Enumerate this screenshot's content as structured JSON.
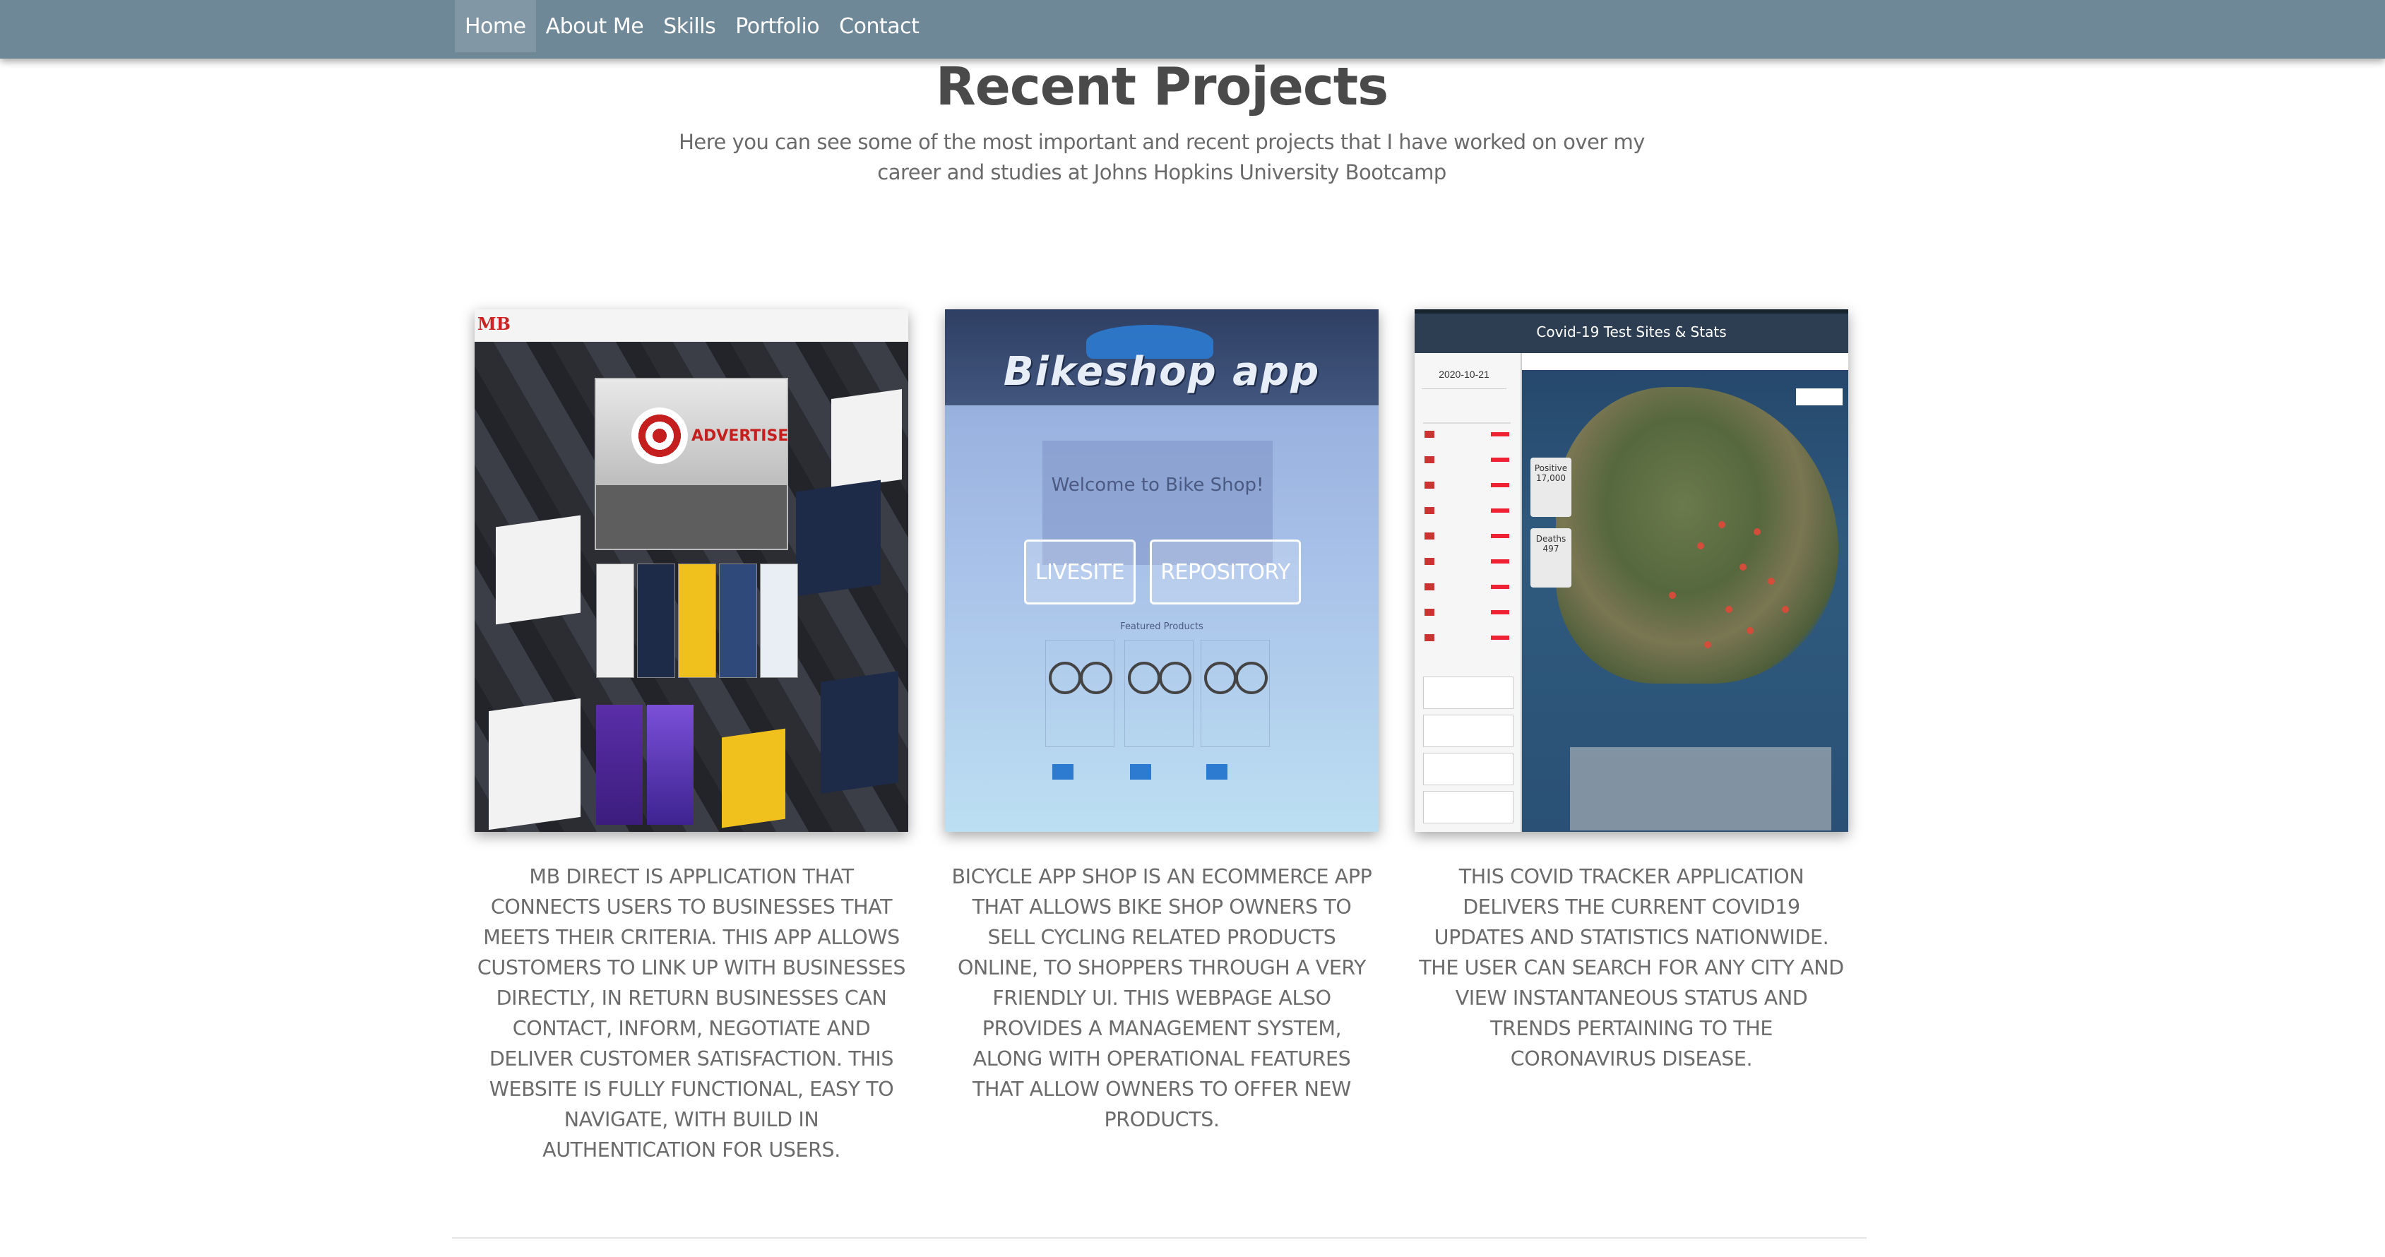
{
  "nav": {
    "items": [
      {
        "label": "Home",
        "active": true
      },
      {
        "label": "About Me",
        "active": false
      },
      {
        "label": "Skills",
        "active": false
      },
      {
        "label": "Portfolio",
        "active": false
      },
      {
        "label": "Contact",
        "active": false
      }
    ],
    "bg_color": "#6f8898"
  },
  "header": {
    "title": "Recent Projects",
    "subtitle": "Here you can see some of the most important and recent projects that I have worked on over my career and studies at Johns Hopkins University Bootcamp"
  },
  "projects": [
    {
      "thumb_logo": "MB",
      "thumb_ad_text": "ADVERTISE",
      "description": "MB DIRECT IS APPLICATION THAT CONNECTS USERS TO BUSINESSES THAT MEETS THEIR CRITERIA. THIS APP ALLOWS CUSTOMERS TO LINK UP WITH BUSINESSES DIRECTLY, IN RETURN BUSINESSES CAN CONTACT, INFORM, NEGOTIATE AND DELIVER CUSTOMER SATISFACTION. THIS WEBSITE IS FULLY FUNCTIONAL, EASY TO NAVIGATE, WITH BUILD IN AUTHENTICATION FOR USERS."
    },
    {
      "thumb_banner": "Bikeshop app",
      "thumb_welcome": "Welcome to Bike Shop!",
      "thumb_featured": "Featured Products",
      "livesite_label": "LIVESITE",
      "repository_label": "REPOSITORY",
      "description": "BICYCLE APP SHOP IS AN ECOMMERCE APP THAT ALLOWS BIKE SHOP OWNERS TO SELL CYCLING RELATED PRODUCTS ONLINE, TO SHOPPERS THROUGH A VERY FRIENDLY UI. THIS WEBPAGE ALSO PROVIDES A MANAGEMENT SYSTEM, ALONG WITH OPERATIONAL FEATURES THAT ALLOW OWNERS TO OFFER NEW PRODUCTS."
    },
    {
      "thumb_header": "Covid-19 Test Sites & Stats",
      "thumb_date": "2020-10-21",
      "thumb_positive": "Positive",
      "thumb_positive_value": "17,000",
      "thumb_deaths": "Deaths",
      "thumb_deaths_value": "497",
      "description": "THIS COVID TRACKER APPLICATION DELIVERS THE CURRENT COVID19 UPDATES AND STATISTICS NATIONWIDE. THE USER CAN SEARCH FOR ANY CITY AND VIEW INSTANTANEOUS STATUS AND TRENDS PERTAINING TO THE CORONAVIRUS DISEASE."
    }
  ]
}
